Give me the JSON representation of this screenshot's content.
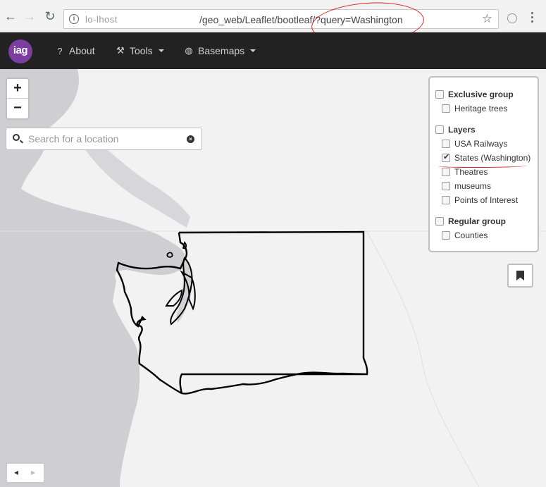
{
  "browser": {
    "url_host": "lo-lhost",
    "url_path": "/geo_web/Leaflet/bootleaf/?query=Washington",
    "back_glyph": "←",
    "forward_glyph": "→",
    "reload_glyph": "↻",
    "star_glyph": "☆"
  },
  "navbar": {
    "logo_text": "iag",
    "items": [
      {
        "label": "About",
        "icon": "question-circle-icon"
      },
      {
        "label": "Tools",
        "icon": "wrench-icon"
      },
      {
        "label": "Basemaps",
        "icon": "globe-icon"
      }
    ],
    "icon_glyphs": {
      "about": "❓",
      "tools": "🔧",
      "basemaps": "🌐"
    }
  },
  "map": {
    "zoom_in": "+",
    "zoom_out": "−",
    "search_placeholder": "Search for a location",
    "clear_glyph": "×",
    "land_color": "#f2f2f2",
    "water_color": "#cfcfd3",
    "outline_color": "#000000"
  },
  "layers": {
    "groups": [
      {
        "name": "Exclusive group",
        "items": [
          {
            "label": "Heritage trees",
            "checked": false
          }
        ]
      },
      {
        "name": "Layers",
        "items": [
          {
            "label": "USA Railways",
            "checked": false
          },
          {
            "label": "States (Washington)",
            "checked": true
          },
          {
            "label": "Theatres",
            "checked": false
          },
          {
            "label": "museums",
            "checked": false
          },
          {
            "label": "Points of Interest",
            "checked": false
          }
        ]
      },
      {
        "name": "Regular group",
        "items": [
          {
            "label": "Counties",
            "checked": false
          }
        ]
      }
    ]
  },
  "sidebar_toggle": {
    "left": "◂",
    "right": "▸"
  }
}
